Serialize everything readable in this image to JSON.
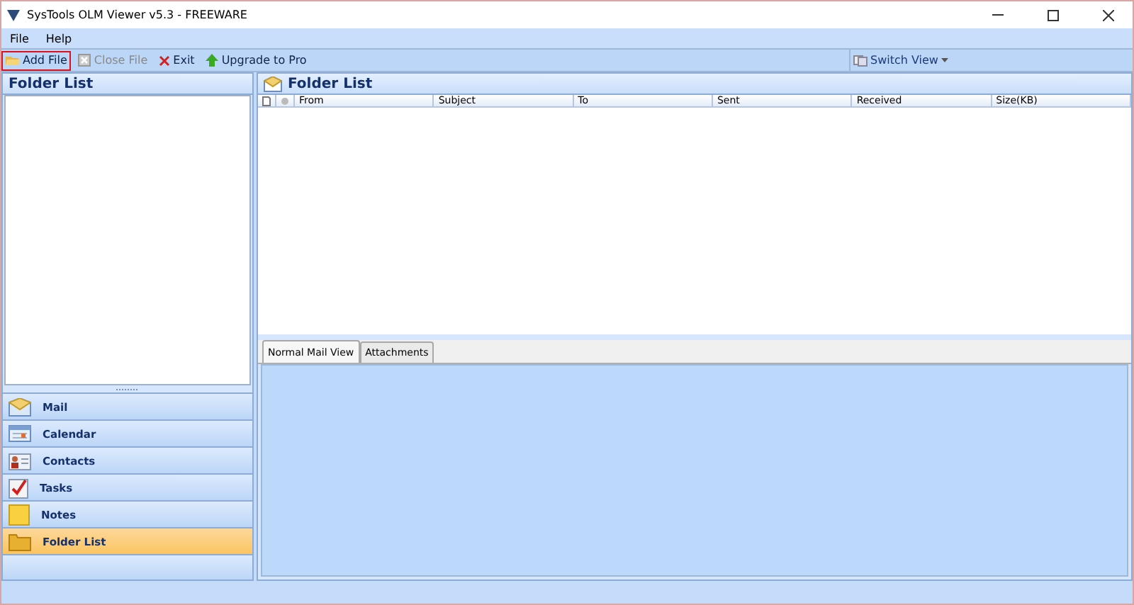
{
  "window": {
    "title": "SysTools OLM Viewer v5.3 - FREEWARE"
  },
  "menu": [
    "File",
    "Help"
  ],
  "toolbar": [
    {
      "kind": "open",
      "label": "Add File",
      "disabled": false,
      "highlighted": true
    },
    {
      "kind": "close",
      "label": "Close File",
      "disabled": true,
      "highlighted": false
    },
    {
      "kind": "exit",
      "label": "Exit",
      "disabled": false,
      "highlighted": false
    },
    {
      "kind": "upgrade",
      "label": "Upgrade to Pro",
      "disabled": false,
      "highlighted": false
    }
  ],
  "switch_view": {
    "label": "Switch View"
  },
  "left_panel": {
    "title": "Folder List"
  },
  "nav": [
    {
      "kind": "mail",
      "label": "Mail",
      "selected": false
    },
    {
      "kind": "calendar",
      "label": "Calendar",
      "selected": false
    },
    {
      "kind": "contacts",
      "label": "Contacts",
      "selected": false
    },
    {
      "kind": "tasks",
      "label": "Tasks",
      "selected": false
    },
    {
      "kind": "notes",
      "label": "Notes",
      "selected": false
    },
    {
      "kind": "folder",
      "label": "Folder List",
      "selected": true
    }
  ],
  "right_panel": {
    "title": "Folder List"
  },
  "table": {
    "columns": [
      "From",
      "Subject",
      "To",
      "Sent",
      "Received",
      "Size(KB)"
    ]
  },
  "preview_tabs": [
    {
      "label": "Normal Mail View",
      "selected": true
    },
    {
      "label": "Attachments",
      "selected": false
    }
  ]
}
